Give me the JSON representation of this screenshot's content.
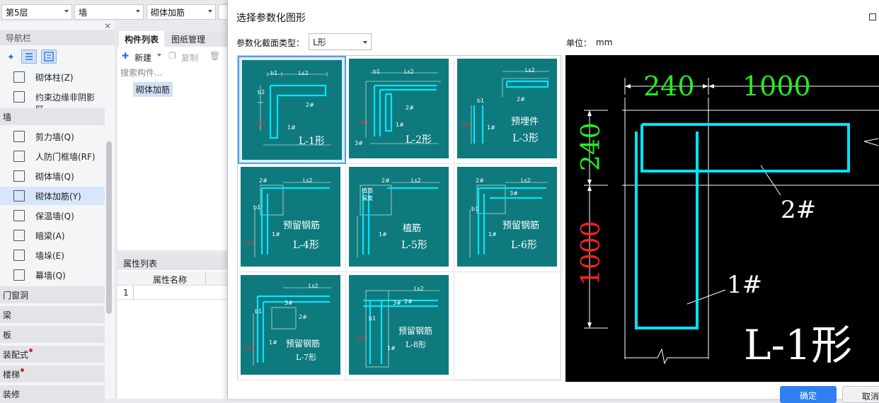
{
  "toolbar": {
    "floor": "第5层",
    "category": "墙",
    "component": "砌体加筋"
  },
  "nav": {
    "title": "导航栏",
    "top_items": [
      {
        "label": "砌体柱(Z)"
      },
      {
        "label": "约束边缘非阴影区.."
      }
    ],
    "group_wall": "墙",
    "wall_items": [
      {
        "label": "剪力墙(Q)"
      },
      {
        "label": "人防门框墙(RF)"
      },
      {
        "label": "砌体墙(Q)"
      },
      {
        "label": "砌体加筋(Y)"
      },
      {
        "label": "保温墙(Q)"
      },
      {
        "label": "暗梁(A)"
      },
      {
        "label": "墙垛(E)"
      },
      {
        "label": "幕墙(Q)"
      }
    ],
    "sections": [
      "门窗洞",
      "梁",
      "板",
      "装配式",
      "楼梯",
      "装修"
    ]
  },
  "mid": {
    "tab_components": "构件列表",
    "tab_drawings": "图纸管理",
    "new_label": "新建",
    "copy_label": "复制",
    "search_placeholder": "搜索构件...",
    "component_item": "砌体加筋",
    "props_title": "属性列表",
    "props_col": "属性名称",
    "props_row1": "1"
  },
  "dialog": {
    "title": "选择参数化图形",
    "type_label": "参数化截面类型：",
    "type_value": "L形",
    "unit_label": "单位：",
    "unit_value": "mm",
    "shapes": [
      {
        "name": "L-1形",
        "caption": ""
      },
      {
        "name": "L-2形",
        "caption": ""
      },
      {
        "name": "L-3形",
        "caption": "预埋件"
      },
      {
        "name": "L-4形",
        "caption": "预留钢筋"
      },
      {
        "name": "L-5形",
        "caption": "植筋"
      },
      {
        "name": "L-6形",
        "caption": "预留钢筋"
      },
      {
        "name": "L-7形",
        "caption": "预留钢筋"
      },
      {
        "name": "L-8形",
        "caption": "预留钢筋"
      }
    ],
    "preview": {
      "dim_b1": "240",
      "dim_ls2": "1000",
      "dim_b2": "240",
      "dim_ls1": "1000",
      "rebar2": "2#",
      "rebar1": "1#",
      "shape_name": "L-1形"
    },
    "ok_label": "确定",
    "cancel_label": "取消"
  },
  "colors": {
    "thumb_bg": "#0e7a7d",
    "rebar": "#00e5ff",
    "dim_green": "#22ee22",
    "dim_red": "#ff2020",
    "primary": "#2f7ff0"
  }
}
